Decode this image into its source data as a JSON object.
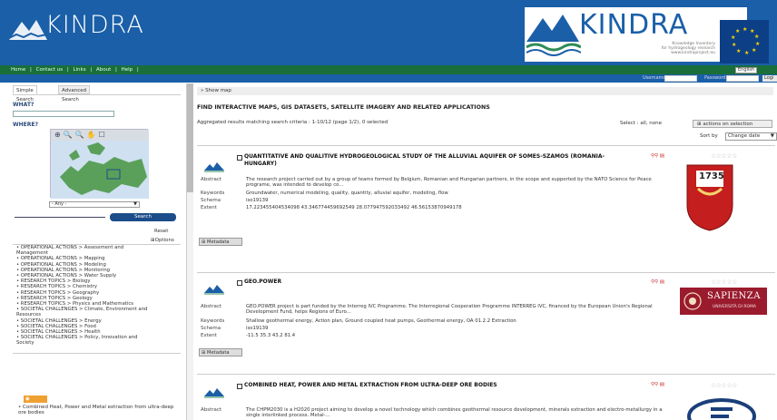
{
  "header": {
    "logo_text": "KINDRA",
    "partner_logo_text": "KINDRA",
    "partner_subtitle_1": "Knowledge Inventory",
    "partner_subtitle_2": "for hydrogeology research",
    "partner_subtitle_3": "www.kindraproject.eu",
    "brand_color": "#1a5fa8"
  },
  "menu": {
    "items": [
      "Home",
      "|",
      "Contact us",
      "|",
      "Links",
      "|",
      "About",
      "|",
      "Help",
      "|"
    ],
    "language": "English"
  },
  "login": {
    "username_label": "Username",
    "password_label": "Password",
    "button_label": "Logi"
  },
  "sidebar": {
    "tab_simple": "Simple Search",
    "tab_advanced": "Advanced Search",
    "what_label": "WHAT?",
    "where_label": "WHERE?",
    "map_tools": "⊕🔍🔍✋☐",
    "region_select": "- Any -",
    "search_button": "Search",
    "reset_link": "Reset",
    "options_link": "Options",
    "categories": [
      "• OPERATIONAL ACTIONS > Assessment and",
      "  Management",
      "• OPERATIONAL ACTIONS > Mapping",
      "• OPERATIONAL ACTIONS > Modeling",
      "• OPERATIONAL ACTIONS > Monitoring",
      "• OPERATIONAL ACTIONS > Water Supply",
      "• RESEARCH TOPICS > Biology",
      "• RESEARCH TOPICS > Chemistry",
      "• RESEARCH TOPICS > Geography",
      "• RESEARCH TOPICS > Geology",
      "• RESEARCH TOPICS > Physics and Mathematics",
      "• SOCIETAL CHALLENGES > Climate, Environment and",
      "  Resources",
      "• SOCIETAL CHALLENGES > Energy",
      "• SOCIETAL CHALLENGES > Food",
      "• SOCIETAL CHALLENGES > Health",
      "• SOCIETAL CHALLENGES > Policy, Innovation and",
      "  Society"
    ],
    "georss_label": "GeoRSS",
    "georss_item": "• Combined Heat, Power and Metal extraction from ultra-deep ore bodies"
  },
  "main": {
    "show_map": "» Show map",
    "find_title": "FIND INTERACTIVE MAPS, GIS DATASETS, SATELLITE IMAGERY AND RELATED APPLICATIONS",
    "aggregated": "Aggregated results matching search criteria : 1-10/12 (page 1/2), 0 selected",
    "select_label": "Select : all, none",
    "actions_button": "⊞ actions on selection",
    "sort_label": "Sort by",
    "sort_value": "Change date",
    "metadata_button": "⊞ Metadata",
    "labels": {
      "abstract": "Abstract",
      "keywords": "Keywords",
      "schema": "Schema",
      "extent": "Extent"
    },
    "records": [
      {
        "title": "QUANTITATIVE AND QUALITIVE HYDROGEOLOGICAL STUDY OF THE ALLUVIAL AQUIFER OF SOMES-SZAMOS (ROMANIA-HUNGARY)",
        "abstract": "The research project carried out by a group of teams formed by Belgium, Romanian and Hungarian partners, in the scope and supported by the NATO Science for Peace programe, was intended to develop co...",
        "keywords": "Groundwater, numerical modeling, quality, quantity, alluvial aquifer, modeling, flow",
        "schema": "iso19139",
        "extent": "17.223455404534098 43.346774459692549 28.077947592033492 46.56153870949178",
        "rating": "☆☆☆☆☆",
        "emblem": "1735"
      },
      {
        "title": "GEO.POWER",
        "abstract": "GEO.POWER project is part funded by the Interreg IVC Programme. The Interregional Cooperation Programme INTERREG IVC, financed by the European Union's Regional Development Fund, helps Regions of Euro...",
        "keywords": "Shallow geothermal energy, Action plan, Ground coupled heat pumps, Geothermal energy, OA 01.2.2 Extraction",
        "schema": "iso19139",
        "extent": "-11.5 35.3 43.2 81.4",
        "rating": "☆☆☆☆☆",
        "emblem": "SAPIENZA",
        "emblem_sub": "UNIVERSITÀ DI ROMA"
      },
      {
        "title": "COMBINED HEAT, POWER AND METAL EXTRACTION FROM ULTRA-DEEP ORE BODIES",
        "abstract": "The CHPM2030 is a H2020 project aiming to develop a novel technology which combines geothermal resource development, minerals extraction and electro-metallurgy in a single interlinked process. Metal-...",
        "rating": "☆☆☆☆☆"
      }
    ]
  }
}
